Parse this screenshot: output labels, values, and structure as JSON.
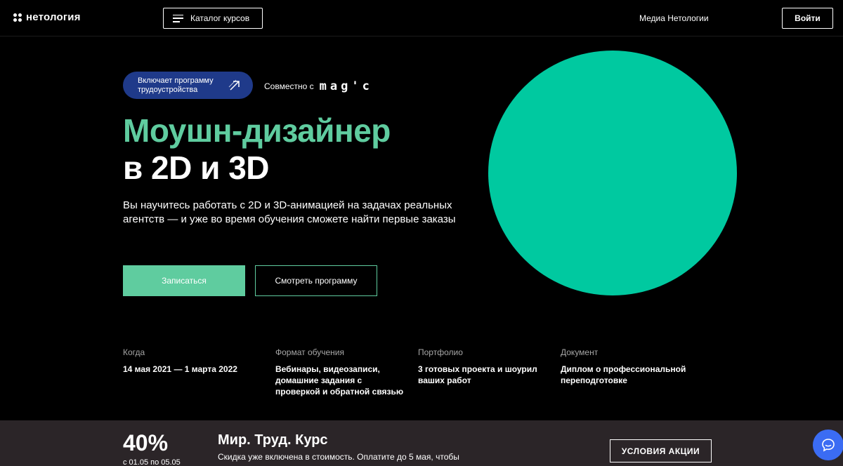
{
  "header": {
    "logo_text": "нетология",
    "catalog_label": "Каталог курсов",
    "media_label": "Медиа Нетологии",
    "login_label": "Войти"
  },
  "hero": {
    "badge_line1": "Включает программу",
    "badge_line2": "трудоустройства",
    "partner_prefix": "Совместно с",
    "partner_logo": "mag'c",
    "title_line1": "Моушн-дизайнер",
    "title_line2": "в 2D и 3D",
    "description": "Вы научитесь работать с 2D и 3D-анимацией на задачах реальных агентств — и уже во время обучения сможете найти первые заказы",
    "primary_button": "Записаться",
    "secondary_button": "Смотреть программу"
  },
  "info": [
    {
      "label": "Когда",
      "value": "14 мая 2021 — 1 марта 2022"
    },
    {
      "label": "Формат обучения",
      "value": "Вебинары, видеозаписи, домашние задания с проверкой и обратной связью"
    },
    {
      "label": "Портфолио",
      "value": "3 готовых проекта и шоурил ваших работ"
    },
    {
      "label": "Документ",
      "value": "Диплом о профессиональной переподготовке"
    }
  ],
  "promo": {
    "discount": "40%",
    "dates": "с 01.05 по 05.05",
    "title": "Мир. Труд. Курс",
    "text": "Скидка уже включена в стоимость. Оплатите до 5 мая, чтобы",
    "button": "УСЛОВИЯ АКЦИИ"
  },
  "colors": {
    "accent": "#5fcc9f",
    "circle": "#00c9a0",
    "badge": "#1f3a8a",
    "chat": "#3b6cf3",
    "promo_bg": "#2b2528"
  },
  "icons": {
    "logo": "netology-logo-icon",
    "catalog": "menu-icon",
    "badge": "arrow-up-right-icon",
    "chat": "chat-icon"
  }
}
